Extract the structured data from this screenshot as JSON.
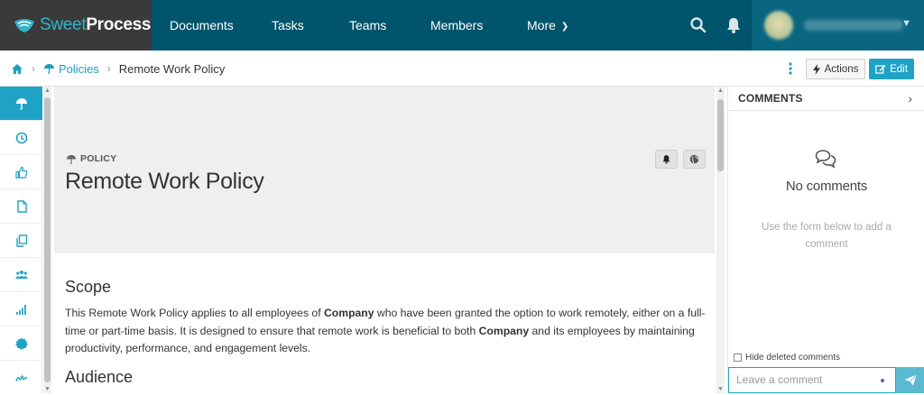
{
  "brand": {
    "name_part1": "Sweet",
    "name_part2": "Process",
    "accent": "#1fa3c4",
    "topbar_color": "#00546b"
  },
  "nav": {
    "items": [
      {
        "label": "Documents"
      },
      {
        "label": "Tasks"
      },
      {
        "label": "Teams"
      },
      {
        "label": "Members"
      },
      {
        "label": "More"
      }
    ],
    "icons": [
      "search-icon",
      "bell-icon",
      "chevron-down-icon"
    ]
  },
  "breadcrumb": {
    "home_icon": "home-icon",
    "section": "Policies",
    "current": "Remote Work Policy"
  },
  "toolbar": {
    "actions_label": "Actions",
    "edit_label": "Edit"
  },
  "rail": {
    "icons": [
      "policy-icon",
      "history-icon",
      "thumbs-up-icon",
      "document-icon",
      "copy-icon",
      "team-icon",
      "chart-icon",
      "badge-icon",
      "signature-icon"
    ]
  },
  "document": {
    "type_label": "POLICY",
    "title": "Remote Work Policy",
    "sections": [
      {
        "heading": "Scope",
        "body": [
          {
            "text": "This Remote Work Policy applies to all employees of "
          },
          {
            "text": "Company",
            "bold": true
          },
          {
            "text": " who have been granted the option to work remotely, either on a full-time or part-time basis. It is designed to ensure that remote work is beneficial to both "
          },
          {
            "text": "Company",
            "bold": true
          },
          {
            "text": " and its employees by maintaining productivity, performance, and engagement levels."
          }
        ]
      },
      {
        "heading": "Audience"
      }
    ]
  },
  "comments": {
    "title": "COMMENTS",
    "empty_title": "No comments",
    "empty_hint": "Use the form below to add a comment",
    "hide_deleted_label": "Hide deleted comments",
    "input_placeholder": "Leave a comment"
  }
}
